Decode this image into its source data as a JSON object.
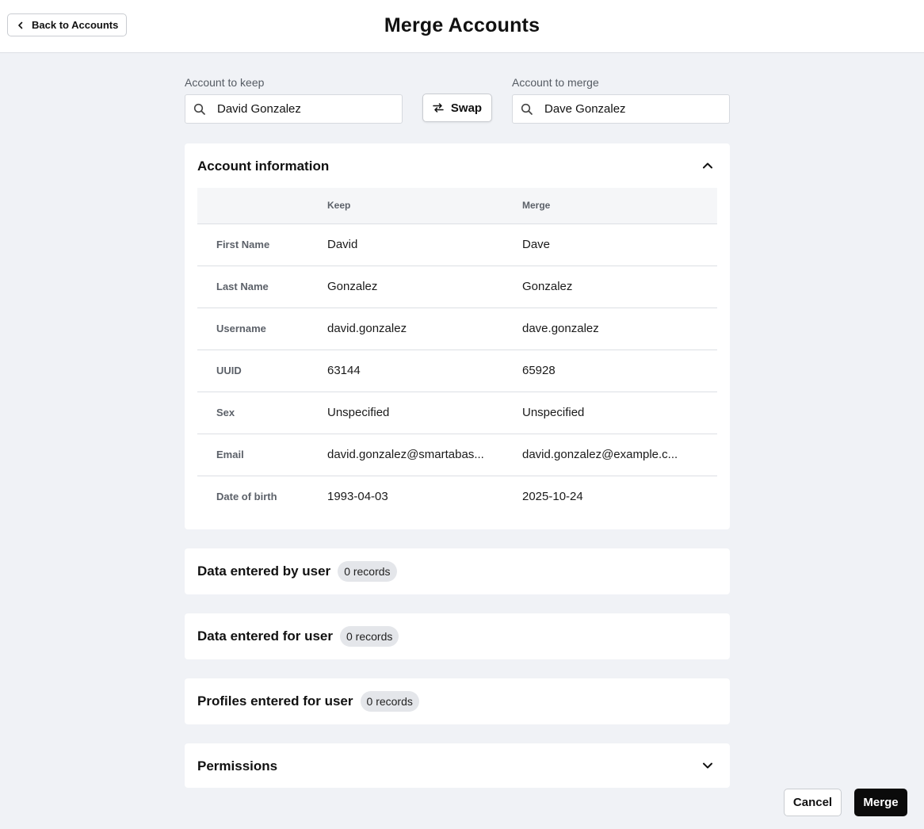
{
  "header": {
    "back_label": "Back to Accounts",
    "title": "Merge Accounts"
  },
  "keep": {
    "label": "Account to keep",
    "value": "David Gonzalez"
  },
  "merge": {
    "label": "Account to merge",
    "value": "Dave Gonzalez"
  },
  "swap_label": "Swap",
  "account_info": {
    "title": "Account information",
    "expanded": true,
    "columns": [
      "",
      "Keep",
      "Merge"
    ],
    "rows": [
      {
        "field": "First Name",
        "keep": "David",
        "merge": "Dave"
      },
      {
        "field": "Last Name",
        "keep": "Gonzalez",
        "merge": "Gonzalez"
      },
      {
        "field": "Username",
        "keep": "david.gonzalez",
        "merge": "dave.gonzalez"
      },
      {
        "field": "UUID",
        "keep": "63144",
        "merge": "65928"
      },
      {
        "field": "Sex",
        "keep": "Unspecified",
        "merge": "Unspecified"
      },
      {
        "field": "Email",
        "keep": "david.gonzalez@smartabas...",
        "merge": "david.gonzalez@example.c..."
      },
      {
        "field": "Date of birth",
        "keep": "1993-04-03",
        "merge": "2025-10-24"
      }
    ]
  },
  "sections": [
    {
      "title": "Data entered by user",
      "badge": "0 records"
    },
    {
      "title": "Data entered for user",
      "badge": "0 records"
    },
    {
      "title": "Profiles entered for user",
      "badge": "0 records"
    }
  ],
  "permissions": {
    "title": "Permissions",
    "expanded": false
  },
  "footer": {
    "cancel_label": "Cancel",
    "merge_label": "Merge"
  }
}
